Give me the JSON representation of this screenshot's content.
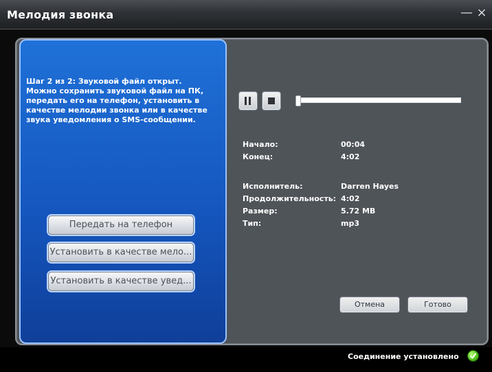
{
  "window": {
    "title": "Мелодия звонка",
    "minimize_icon": "minimize-icon",
    "close_icon": "close-icon"
  },
  "left_panel": {
    "step_text": "Шаг 2 из 2: Звуковой файл открыт.\nМожно сохранить звуковой файл на ПК,\nпередать его на телефон, установить в\nкачестве мелодии звонка или в качестве\nзвука уведомления о SMS-сообщении.",
    "buttons": [
      {
        "label": "Передать на телефон"
      },
      {
        "label": "Установить в качестве мело..."
      },
      {
        "label": "Установить в качестве увед..."
      }
    ]
  },
  "player": {
    "pause_icon": "pause-icon",
    "stop_icon": "stop-icon",
    "progress": 0.0
  },
  "info": {
    "start_label": "Начало:",
    "start_value": "00:04",
    "end_label": "Конец:",
    "end_value": "4:02",
    "artist_label": "Исполнитель:",
    "artist_value": "Darren Hayes",
    "duration_label": "Продолжительность:",
    "duration_value": "4:02",
    "size_label": "Размер:",
    "size_value": "5.72 MB",
    "type_label": "Тип:",
    "type_value": "mp3"
  },
  "actions": {
    "cancel_label": "Отмена",
    "done_label": "Готово"
  },
  "status": {
    "text": "Соединение установлено",
    "icon": "check-icon",
    "color": "#58c51b"
  },
  "colors": {
    "left_panel_blue": "#1557bf",
    "right_panel_gray": "#4f5459"
  }
}
